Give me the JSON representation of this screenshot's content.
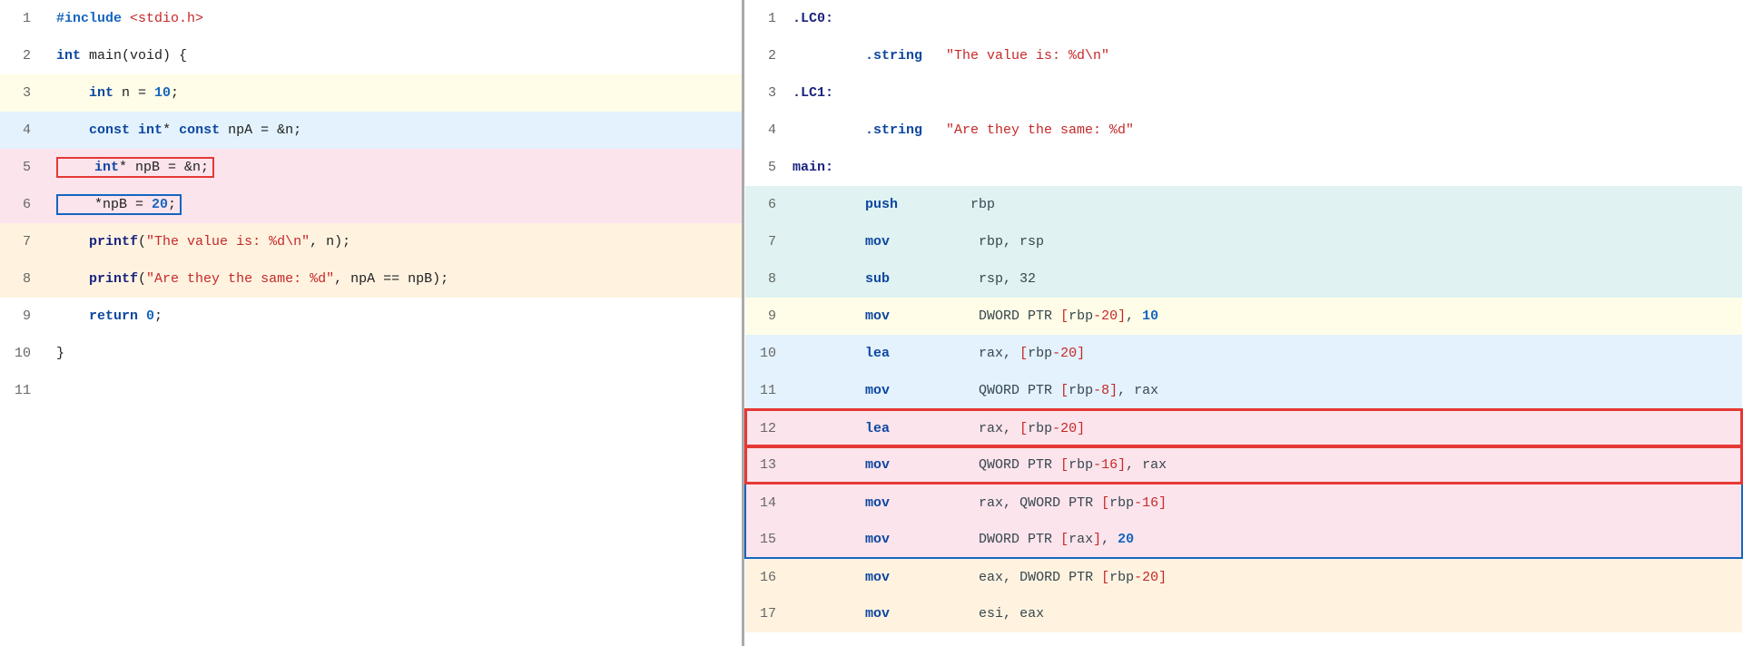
{
  "left": {
    "lines": [
      {
        "num": 1,
        "bg": "bg-white",
        "tokens": [
          {
            "t": "#include ",
            "c": "c-include"
          },
          {
            "t": "<stdio.h>",
            "c": "c-header"
          }
        ]
      },
      {
        "num": 2,
        "bg": "bg-white",
        "tokens": [
          {
            "t": "int",
            "c": "c-type"
          },
          {
            "t": " main(void) {",
            "c": "c-plain"
          }
        ]
      },
      {
        "num": 3,
        "bg": "bg-yellow",
        "tokens": [
          {
            "t": "    int",
            "c": "c-type"
          },
          {
            "t": " n = ",
            "c": "c-plain"
          },
          {
            "t": "10",
            "c": "c-number"
          },
          {
            "t": ";",
            "c": "c-plain"
          }
        ]
      },
      {
        "num": 4,
        "bg": "bg-blue-light",
        "tokens": [
          {
            "t": "    ",
            "c": "c-plain"
          },
          {
            "t": "const",
            "c": "c-keyword"
          },
          {
            "t": " ",
            "c": "c-plain"
          },
          {
            "t": "int",
            "c": "c-type"
          },
          {
            "t": "* ",
            "c": "c-plain"
          },
          {
            "t": "const",
            "c": "c-keyword"
          },
          {
            "t": " npA = &n;",
            "c": "c-plain"
          }
        ]
      },
      {
        "num": 5,
        "bg": "bg-red-light",
        "box": "red",
        "tokens": [
          {
            "t": "    ",
            "c": "c-plain"
          },
          {
            "t": "int",
            "c": "c-type"
          },
          {
            "t": "* npB = &n;",
            "c": "c-plain"
          }
        ]
      },
      {
        "num": 6,
        "bg": "bg-red-light",
        "box": "blue",
        "tokens": [
          {
            "t": "    *npB = ",
            "c": "c-plain"
          },
          {
            "t": "20",
            "c": "c-number"
          },
          {
            "t": ";",
            "c": "c-plain"
          }
        ]
      },
      {
        "num": 7,
        "bg": "bg-orange-light",
        "tokens": [
          {
            "t": "    ",
            "c": "c-plain"
          },
          {
            "t": "printf",
            "c": "c-func"
          },
          {
            "t": "(",
            "c": "c-plain"
          },
          {
            "t": "\"The value is: %d\\n\"",
            "c": "c-string"
          },
          {
            "t": ", n);",
            "c": "c-plain"
          }
        ]
      },
      {
        "num": 8,
        "bg": "bg-orange-light",
        "tokens": [
          {
            "t": "    ",
            "c": "c-plain"
          },
          {
            "t": "printf",
            "c": "c-func"
          },
          {
            "t": "(",
            "c": "c-plain"
          },
          {
            "t": "\"Are they the same: %d\"",
            "c": "c-string"
          },
          {
            "t": ", npA == npB);",
            "c": "c-plain"
          }
        ]
      },
      {
        "num": 9,
        "bg": "bg-white",
        "tokens": [
          {
            "t": "    return ",
            "c": "c-keyword"
          },
          {
            "t": "0",
            "c": "c-number"
          },
          {
            "t": ";",
            "c": "c-plain"
          }
        ]
      },
      {
        "num": 10,
        "bg": "bg-white",
        "tokens": [
          {
            "t": "}",
            "c": "c-plain"
          }
        ]
      },
      {
        "num": 11,
        "bg": "bg-white",
        "tokens": []
      }
    ]
  },
  "right": {
    "lines": [
      {
        "num": 1,
        "bg": "bg-white",
        "indent": "",
        "instr": ".LC0:",
        "operands": "",
        "instrC": "a-label",
        "operandsC": "a-operand",
        "boxRow": ""
      },
      {
        "num": 2,
        "bg": "bg-white",
        "indent": "        ",
        "instr": ".string",
        "operands": " \"The value is: %d\\n\"",
        "instrC": "a-instr",
        "operandsC": "a-string",
        "boxRow": ""
      },
      {
        "num": 3,
        "bg": "bg-white",
        "indent": "",
        "instr": ".LC1:",
        "operands": "",
        "instrC": "a-label",
        "operandsC": "a-operand",
        "boxRow": ""
      },
      {
        "num": 4,
        "bg": "bg-white",
        "indent": "        ",
        "instr": ".string",
        "operands": " \"Are they the same: %d\"",
        "instrC": "a-instr",
        "operandsC": "a-string",
        "boxRow": ""
      },
      {
        "num": 5,
        "bg": "bg-white",
        "indent": "",
        "instr": "main:",
        "operands": "",
        "instrC": "a-label",
        "operandsC": "a-operand",
        "boxRow": ""
      },
      {
        "num": 6,
        "bg": "bg-teal-light",
        "indent": "        ",
        "instr": "push",
        "operands": "    rbp",
        "instrC": "a-instr",
        "operandsC": "a-reg",
        "boxRow": ""
      },
      {
        "num": 7,
        "bg": "bg-teal-light",
        "indent": "        ",
        "instr": "mov",
        "operands": "     rbp, rsp",
        "instrC": "a-instr",
        "operandsC": "a-reg",
        "boxRow": ""
      },
      {
        "num": 8,
        "bg": "bg-teal-light",
        "indent": "        ",
        "instr": "sub",
        "operands": "     rsp, 32",
        "instrC": "a-instr",
        "operandsC": "a-operand",
        "boxRow": ""
      },
      {
        "num": 9,
        "bg": "bg-yellow",
        "indent": "        ",
        "instr": "mov",
        "operands": "     DWORD PTR [rbp-20], 10",
        "instrC": "a-instr",
        "operandsC": "",
        "boxRow": ""
      },
      {
        "num": 10,
        "bg": "bg-blue-light",
        "indent": "        ",
        "instr": "lea",
        "operands": "     rax, [rbp-20]",
        "instrC": "a-instr",
        "operandsC": "",
        "boxRow": ""
      },
      {
        "num": 11,
        "bg": "bg-blue-light",
        "indent": "        ",
        "instr": "mov",
        "operands": "     QWORD PTR [rbp-8], rax",
        "instrC": "a-instr",
        "operandsC": "",
        "boxRow": ""
      },
      {
        "num": 12,
        "bg": "bg-red-light",
        "indent": "        ",
        "instr": "lea",
        "operands": "     rax, [rbp-20]",
        "instrC": "a-instr",
        "operandsC": "",
        "boxRow": "red"
      },
      {
        "num": 13,
        "bg": "bg-red-light",
        "indent": "        ",
        "instr": "mov",
        "operands": "     QWORD PTR [rbp-16], rax",
        "instrC": "a-instr",
        "operandsC": "",
        "boxRow": "red"
      },
      {
        "num": 14,
        "bg": "bg-red-light",
        "indent": "        ",
        "instr": "mov",
        "operands": "     rax, QWORD PTR [rbp-16]",
        "instrC": "a-instr",
        "operandsC": "",
        "boxRow": "blue"
      },
      {
        "num": 15,
        "bg": "bg-red-light",
        "indent": "        ",
        "instr": "mov",
        "operands": "     DWORD PTR [rax], 20",
        "instrC": "a-instr",
        "operandsC": "",
        "boxRow": "blue"
      },
      {
        "num": 16,
        "bg": "bg-orange-light",
        "indent": "        ",
        "instr": "mov",
        "operands": "     eax, DWORD PTR [rbp-20]",
        "instrC": "a-instr",
        "operandsC": "",
        "boxRow": ""
      },
      {
        "num": 17,
        "bg": "bg-orange-light",
        "indent": "        ",
        "instr": "mov",
        "operands": "     esi, eax",
        "instrC": "a-instr",
        "operandsC": "",
        "boxRow": ""
      }
    ]
  }
}
